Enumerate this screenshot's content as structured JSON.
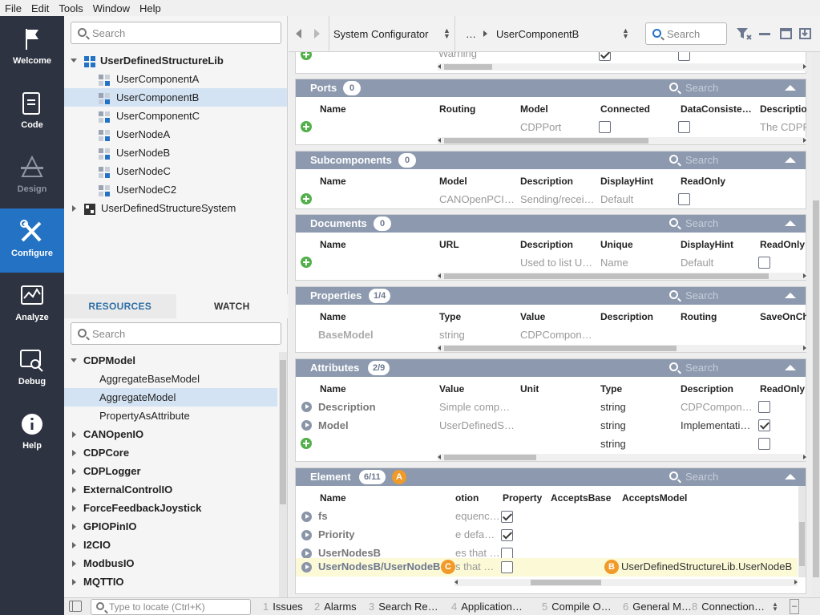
{
  "menu": [
    "File",
    "Edit",
    "Tools",
    "Window",
    "Help"
  ],
  "nav": [
    {
      "label": "Welcome",
      "icon": "flag-icon"
    },
    {
      "label": "Code",
      "icon": "document-icon"
    },
    {
      "label": "Design",
      "icon": "design-icon"
    },
    {
      "label": "Configure",
      "icon": "tools-icon"
    },
    {
      "label": "Analyze",
      "icon": "chart-icon"
    },
    {
      "label": "Debug",
      "icon": "debug-icon"
    },
    {
      "label": "Help",
      "icon": "info-icon"
    }
  ],
  "tree": {
    "search_placeholder": "Search",
    "lib": "UserDefinedStructureLib",
    "items": [
      "UserComponentA",
      "UserComponentB",
      "UserComponentC",
      "UserNodeA",
      "UserNodeB",
      "UserNodeC",
      "UserNodeC2"
    ],
    "system": "UserDefinedStructureSystem"
  },
  "resources": {
    "tabs": [
      "RESOURCES",
      "WATCH"
    ],
    "search_placeholder": "Search",
    "items": [
      {
        "label": "CDPModel",
        "bold": true
      },
      {
        "label": "AggregateBaseModel",
        "bold": false
      },
      {
        "label": "AggregateModel",
        "bold": false
      },
      {
        "label": "PropertyAsAttribute",
        "bold": false
      },
      {
        "label": "CANOpenIO",
        "bold": true
      },
      {
        "label": "CDPCore",
        "bold": true
      },
      {
        "label": "CDPLogger",
        "bold": true
      },
      {
        "label": "ExternalControlIO",
        "bold": true
      },
      {
        "label": "ForceFeedbackJoystick",
        "bold": true
      },
      {
        "label": "GPIOPinIO",
        "bold": true
      },
      {
        "label": "I2CIO",
        "bold": true
      },
      {
        "label": "ModbusIO",
        "bold": true
      },
      {
        "label": "MQTTIO",
        "bold": true
      }
    ]
  },
  "toolbar": {
    "breadcrumb1": "System Configurator",
    "ellipsis": "…",
    "breadcrumb2": "UserComponentB",
    "search_placeholder": "Search"
  },
  "top_row": {
    "value": "Warning"
  },
  "ports": {
    "title": "Ports",
    "count": "0",
    "search": "Search",
    "headers": [
      "Name",
      "Routing",
      "Model",
      "Connected",
      "DataConsiste…",
      "Descriptio"
    ],
    "row": {
      "model": "CDPPort",
      "description": "The CDPP"
    }
  },
  "subcomponents": {
    "title": "Subcomponents",
    "count": "0",
    "search": "Search",
    "headers": [
      "Name",
      "Model",
      "Description",
      "DisplayHint",
      "ReadOnly"
    ],
    "row": {
      "model": "CANOpenPCI…",
      "description": "Sending/recei…",
      "displayhint": "Default"
    }
  },
  "documents": {
    "title": "Documents",
    "count": "0",
    "search": "Search",
    "headers": [
      "Name",
      "URL",
      "Description",
      "Unique",
      "DisplayHint",
      "ReadOnly"
    ],
    "row": {
      "description": "Used to list U…",
      "unique": "Name",
      "displayhint": "Default"
    }
  },
  "properties": {
    "title": "Properties",
    "count": "1/4",
    "search": "Search",
    "headers": [
      "Name",
      "Type",
      "Value",
      "Description",
      "Routing",
      "SaveOnCh"
    ],
    "row": {
      "name": "BaseModel",
      "type": "string",
      "value": "CDPCompon…"
    }
  },
  "attributes": {
    "title": "Attributes",
    "count": "2/9",
    "search": "Search",
    "headers": [
      "Name",
      "Value",
      "Unit",
      "Type",
      "Description",
      "ReadOnly"
    ],
    "rows": [
      {
        "name": "Description",
        "value": "Simple comp…",
        "type": "string",
        "description": "CDPCompon…",
        "readonly": false
      },
      {
        "name": "Model",
        "value": "UserDefinedS…",
        "type": "string",
        "description": "Implementati…",
        "readonly": true
      }
    ],
    "new_row": {
      "type": "string"
    }
  },
  "element": {
    "title": "Element",
    "count": "6/11",
    "search": "Search",
    "marker_a": "A",
    "marker_b": "B",
    "marker_c": "C",
    "headers": [
      "Name",
      "otion",
      "Property",
      "AcceptsBase",
      "AcceptsModel"
    ],
    "rows": [
      {
        "name": "fs",
        "desc": "equenc…",
        "property": true
      },
      {
        "name": "Priority",
        "desc": "e defa…",
        "property": true
      },
      {
        "name": "UserNodesB",
        "desc": "es that …",
        "property": false
      },
      {
        "name": "UserNodesB/UserNodeB",
        "desc": "s that …",
        "property": false,
        "accepts_model": "UserDefinedStructureLib.UserNodeB"
      }
    ]
  },
  "status": {
    "locate_placeholder": "Type to locate (Ctrl+K)",
    "tabs": [
      {
        "n": "1",
        "label": "Issues"
      },
      {
        "n": "2",
        "label": "Alarms"
      },
      {
        "n": "3",
        "label": "Search Re…"
      },
      {
        "n": "4",
        "label": "Application…"
      },
      {
        "n": "5",
        "label": "Compile O…"
      },
      {
        "n": "6",
        "label": "General M…"
      },
      {
        "n": "8",
        "label": "Connection…"
      }
    ]
  }
}
